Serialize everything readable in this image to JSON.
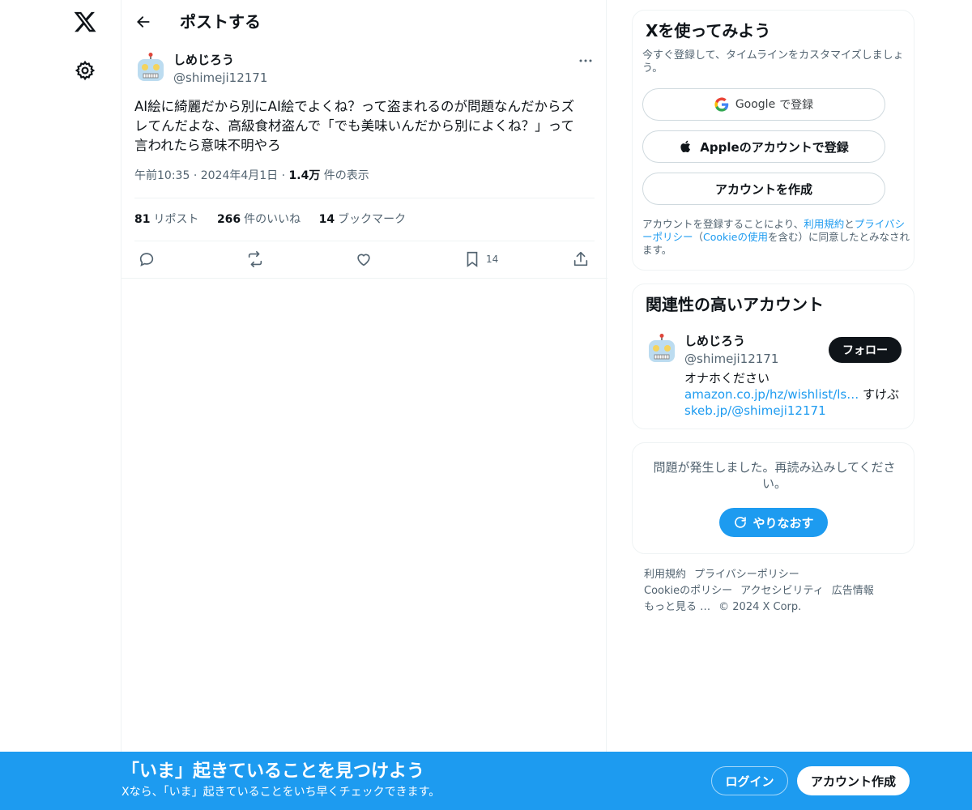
{
  "colors": {
    "accent": "#1d9bf0",
    "text": "#0f1419",
    "muted": "#536471",
    "border": "#eff3f4"
  },
  "nav": {
    "logo_icon": "x-logo-icon",
    "settings_icon": "gear-icon"
  },
  "header": {
    "title": "ポストする"
  },
  "tweet": {
    "author_name": "しめじろう",
    "author_handle": "@shimeji12171",
    "text_lines": [
      "AI絵に綺麗だから別にAI絵でよくね？って盗まれるのが問題なんだからズ",
      "レてんだよな、高級食材盗んで「でも美味いんだから別によくね？」って",
      "言われたら意味不明やろ"
    ],
    "time": "午前10:35",
    "date": "2024年4月1日",
    "views_count": "1.4万",
    "views_label": "件の表示",
    "reposts_count": "81",
    "reposts_label": "リポスト",
    "likes_count": "266",
    "likes_label": "件のいいね",
    "bookmarks_count": "14",
    "bookmarks_label": "ブックマーク",
    "bookmark_action_count": "14"
  },
  "signup_card": {
    "title": "Xを使ってみよう",
    "subtitle": "今すぐ登録して、タイムラインをカスタマイズしましょう。",
    "google_brand": "Google",
    "google_label": "で登録",
    "apple_label": "Appleのアカウントで登録",
    "create_label": "アカウントを作成",
    "legal_prefix": "アカウントを登録することにより、",
    "legal_terms": "利用規約",
    "legal_and": "と",
    "legal_privacy": "プライバシーポリシー",
    "legal_mid": "（",
    "legal_cookie": "Cookieの使用",
    "legal_suffix": "を含む）に同意したとみなされます。"
  },
  "related_card": {
    "title": "関連性の高いアカウント",
    "name": "しめじろう",
    "handle": "@shimeji12171",
    "follow_label": "フォロー",
    "bio_line1": "オナホください",
    "bio_link1": "amazon.co.jp/hz/wishlist/ls…",
    "bio_mid": " すけぶ",
    "bio_link2": "skeb.jp/@shimeji12171"
  },
  "error_card": {
    "message": "問題が発生しました。再読み込みしてください。",
    "retry_label": "やりなおす"
  },
  "footer": {
    "links": [
      "利用規約",
      "プライバシーポリシー",
      "Cookieのポリシー",
      "アクセシビリティ",
      "広告情報",
      "もっと見る …"
    ],
    "copyright": "© 2024 X Corp."
  },
  "bottom_bar": {
    "title": "「いま」起きていることを見つけよう",
    "subtitle": "Xなら、「いま」起きていることをいち早くチェックできます。",
    "login_label": "ログイン",
    "signup_label": "アカウント作成"
  }
}
